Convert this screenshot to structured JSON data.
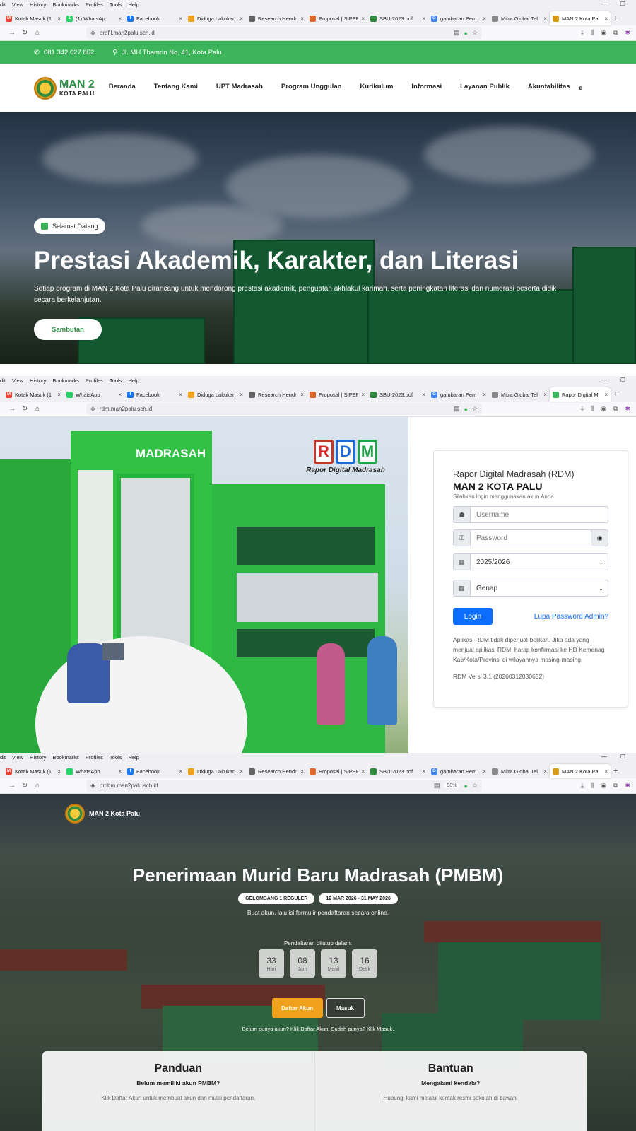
{
  "browser": {
    "menu": [
      "Edit",
      "View",
      "History",
      "Bookmarks",
      "Profiles",
      "Tools",
      "Help"
    ],
    "menu_s1": [
      "dit",
      "View",
      "History",
      "Bookmarks",
      "Profiles",
      "Tools",
      "Help"
    ]
  },
  "shot1": {
    "tabs": [
      {
        "label": "Kotak Masuk (1",
        "color": "#ea4335",
        "g": "M"
      },
      {
        "label": "(1) WhatsAp",
        "color": "#25d366",
        "g": "1"
      },
      {
        "label": "Facebook",
        "color": "#1877f2",
        "g": "f"
      },
      {
        "label": "Diduga Lakukan",
        "color": "#f0a21c",
        "g": ""
      },
      {
        "label": "Research Hendr",
        "color": "#666",
        "g": ""
      },
      {
        "label": "Proposal | SIPER",
        "color": "#e0672a",
        "g": ""
      },
      {
        "label": "SBU-2023.pdf",
        "color": "#2e8b3e",
        "g": ""
      },
      {
        "label": "gambaran Pem",
        "color": "#4285f4",
        "g": "G"
      },
      {
        "label": "Mitra Global Tel",
        "color": "#888",
        "g": ""
      },
      {
        "label": "MAN 2 Kota Pal",
        "color": "#d89a1c",
        "g": ""
      }
    ],
    "url": "profil.man2palu.sch.id",
    "phone": "081 342 027 852",
    "address": "Jl. MH Thamrin No. 41, Kota Palu",
    "logo_main": "MAN 2",
    "logo_sub": "KOTA PALU",
    "nav": [
      "Beranda",
      "Tentang Kami",
      "UPT Madrasah",
      "Program Unggulan",
      "Kurikulum",
      "Informasi",
      "Layanan Publik",
      "Akuntabilitas"
    ],
    "pill": "Selamat Datang",
    "headline": "Prestasi Akademik, Karakter, dan Literasi",
    "subtext": "Setiap program di MAN 2 Kota Palu dirancang untuk mendorong prestasi akademik, penguatan akhlakul karimah, serta peningkatan literasi dan numerasi peserta didik secara berkelanjutan.",
    "cta": "Sambutan"
  },
  "shot2": {
    "tabs": [
      {
        "label": "Kotak Masuk (1",
        "color": "#ea4335",
        "g": "M"
      },
      {
        "label": "WhatsApp",
        "color": "#25d366",
        "g": ""
      },
      {
        "label": "Facebook",
        "color": "#1877f2",
        "g": "f"
      },
      {
        "label": "Diduga Lakukan",
        "color": "#f0a21c",
        "g": ""
      },
      {
        "label": "Research Hendr",
        "color": "#666",
        "g": ""
      },
      {
        "label": "Proposal | SIPER",
        "color": "#e0672a",
        "g": ""
      },
      {
        "label": "SBU-2023.pdf",
        "color": "#2e8b3e",
        "g": ""
      },
      {
        "label": "gambaran Pem",
        "color": "#4285f4",
        "g": "G"
      },
      {
        "label": "Mitra Global Tel",
        "color": "#888",
        "g": ""
      },
      {
        "label": "Rapor Digital M",
        "color": "#3cb55a",
        "g": ""
      }
    ],
    "url": "rdm.man2palu.sch.id",
    "madrasah_sign": "MADRASAH",
    "rdm_letters": [
      "R",
      "D",
      "M"
    ],
    "rdm_caption": "Rapor Digital Madrasah",
    "login_title": "Rapor Digital Madrasah (RDM)",
    "login_school": "MAN 2 KOTA PALU",
    "login_hint": "Silahkan login menggunakan akun Anda",
    "username_placeholder": "Username",
    "password_placeholder": "Password",
    "year_value": "2025/2026",
    "semester_value": "Genap",
    "login_button": "Login",
    "forgot_link": "Lupa Password Admin?",
    "note": "Aplikasi RDM tidak diperjual-belikan. Jika ada yang menjual aplikasi RDM, harap konfirmasi ke HD Kemenag Kab/Kota/Provinsi di wilayahnya masing-masing.",
    "version": "RDM Versi 3.1 (20260312030652)"
  },
  "shot3": {
    "tabs": [
      {
        "label": "Kotak Masuk (1",
        "color": "#ea4335",
        "g": "M"
      },
      {
        "label": "WhatsApp",
        "color": "#25d366",
        "g": ""
      },
      {
        "label": "Facebook",
        "color": "#1877f2",
        "g": "f"
      },
      {
        "label": "Diduga Lakukan",
        "color": "#f0a21c",
        "g": ""
      },
      {
        "label": "Research Hendr",
        "color": "#666",
        "g": ""
      },
      {
        "label": "Proposal | SIPER",
        "color": "#e0672a",
        "g": ""
      },
      {
        "label": "SBU-2023.pdf",
        "color": "#2e8b3e",
        "g": ""
      },
      {
        "label": "gambaran Pem",
        "color": "#4285f4",
        "g": "G"
      },
      {
        "label": "Mitra Global Tel",
        "color": "#888",
        "g": ""
      },
      {
        "label": "MAN 2 Kota Pal",
        "color": "#d89a1c",
        "g": ""
      }
    ],
    "url": "pmbm.man2palu.sch.id",
    "zoom": "90%",
    "logo_text": "MAN 2 Kota Palu",
    "headline": "Penerimaan Murid Baru Madrasah (PMBM)",
    "badge1": "GELOMBANG 1 REGULER",
    "badge2": "12 MAR 2026 - 31 MAY 2026",
    "desc": "Buat akun, lalu isi formulir pendaftaran secara online.",
    "countdown_label": "Pendaftaran ditutup dalam:",
    "countdown": [
      {
        "n": "33",
        "l": "Hari"
      },
      {
        "n": "08",
        "l": "Jam"
      },
      {
        "n": "13",
        "l": "Menit"
      },
      {
        "n": "16",
        "l": "Detik"
      }
    ],
    "btn_daftar": "Daftar Akun",
    "btn_masuk": "Masuk",
    "hint": "Belum punya akun? Klik Daftar Akun. Sudah punya? Klik Masuk.",
    "card1_title": "Panduan",
    "card1_sub": "Belum memiliki akun PMBM?",
    "card1_desc": "Klik Daftar Akun untuk membuat akun dan mulai pendaftaran.",
    "card2_title": "Bantuan",
    "card2_sub": "Mengalami kendala?",
    "card2_desc": "Hubungi kami melalui kontak resmi sekolah di bawah."
  },
  "colors": {
    "green": "#3cb55a",
    "blue": "#0d6efd",
    "orange": "#f0a21c"
  }
}
